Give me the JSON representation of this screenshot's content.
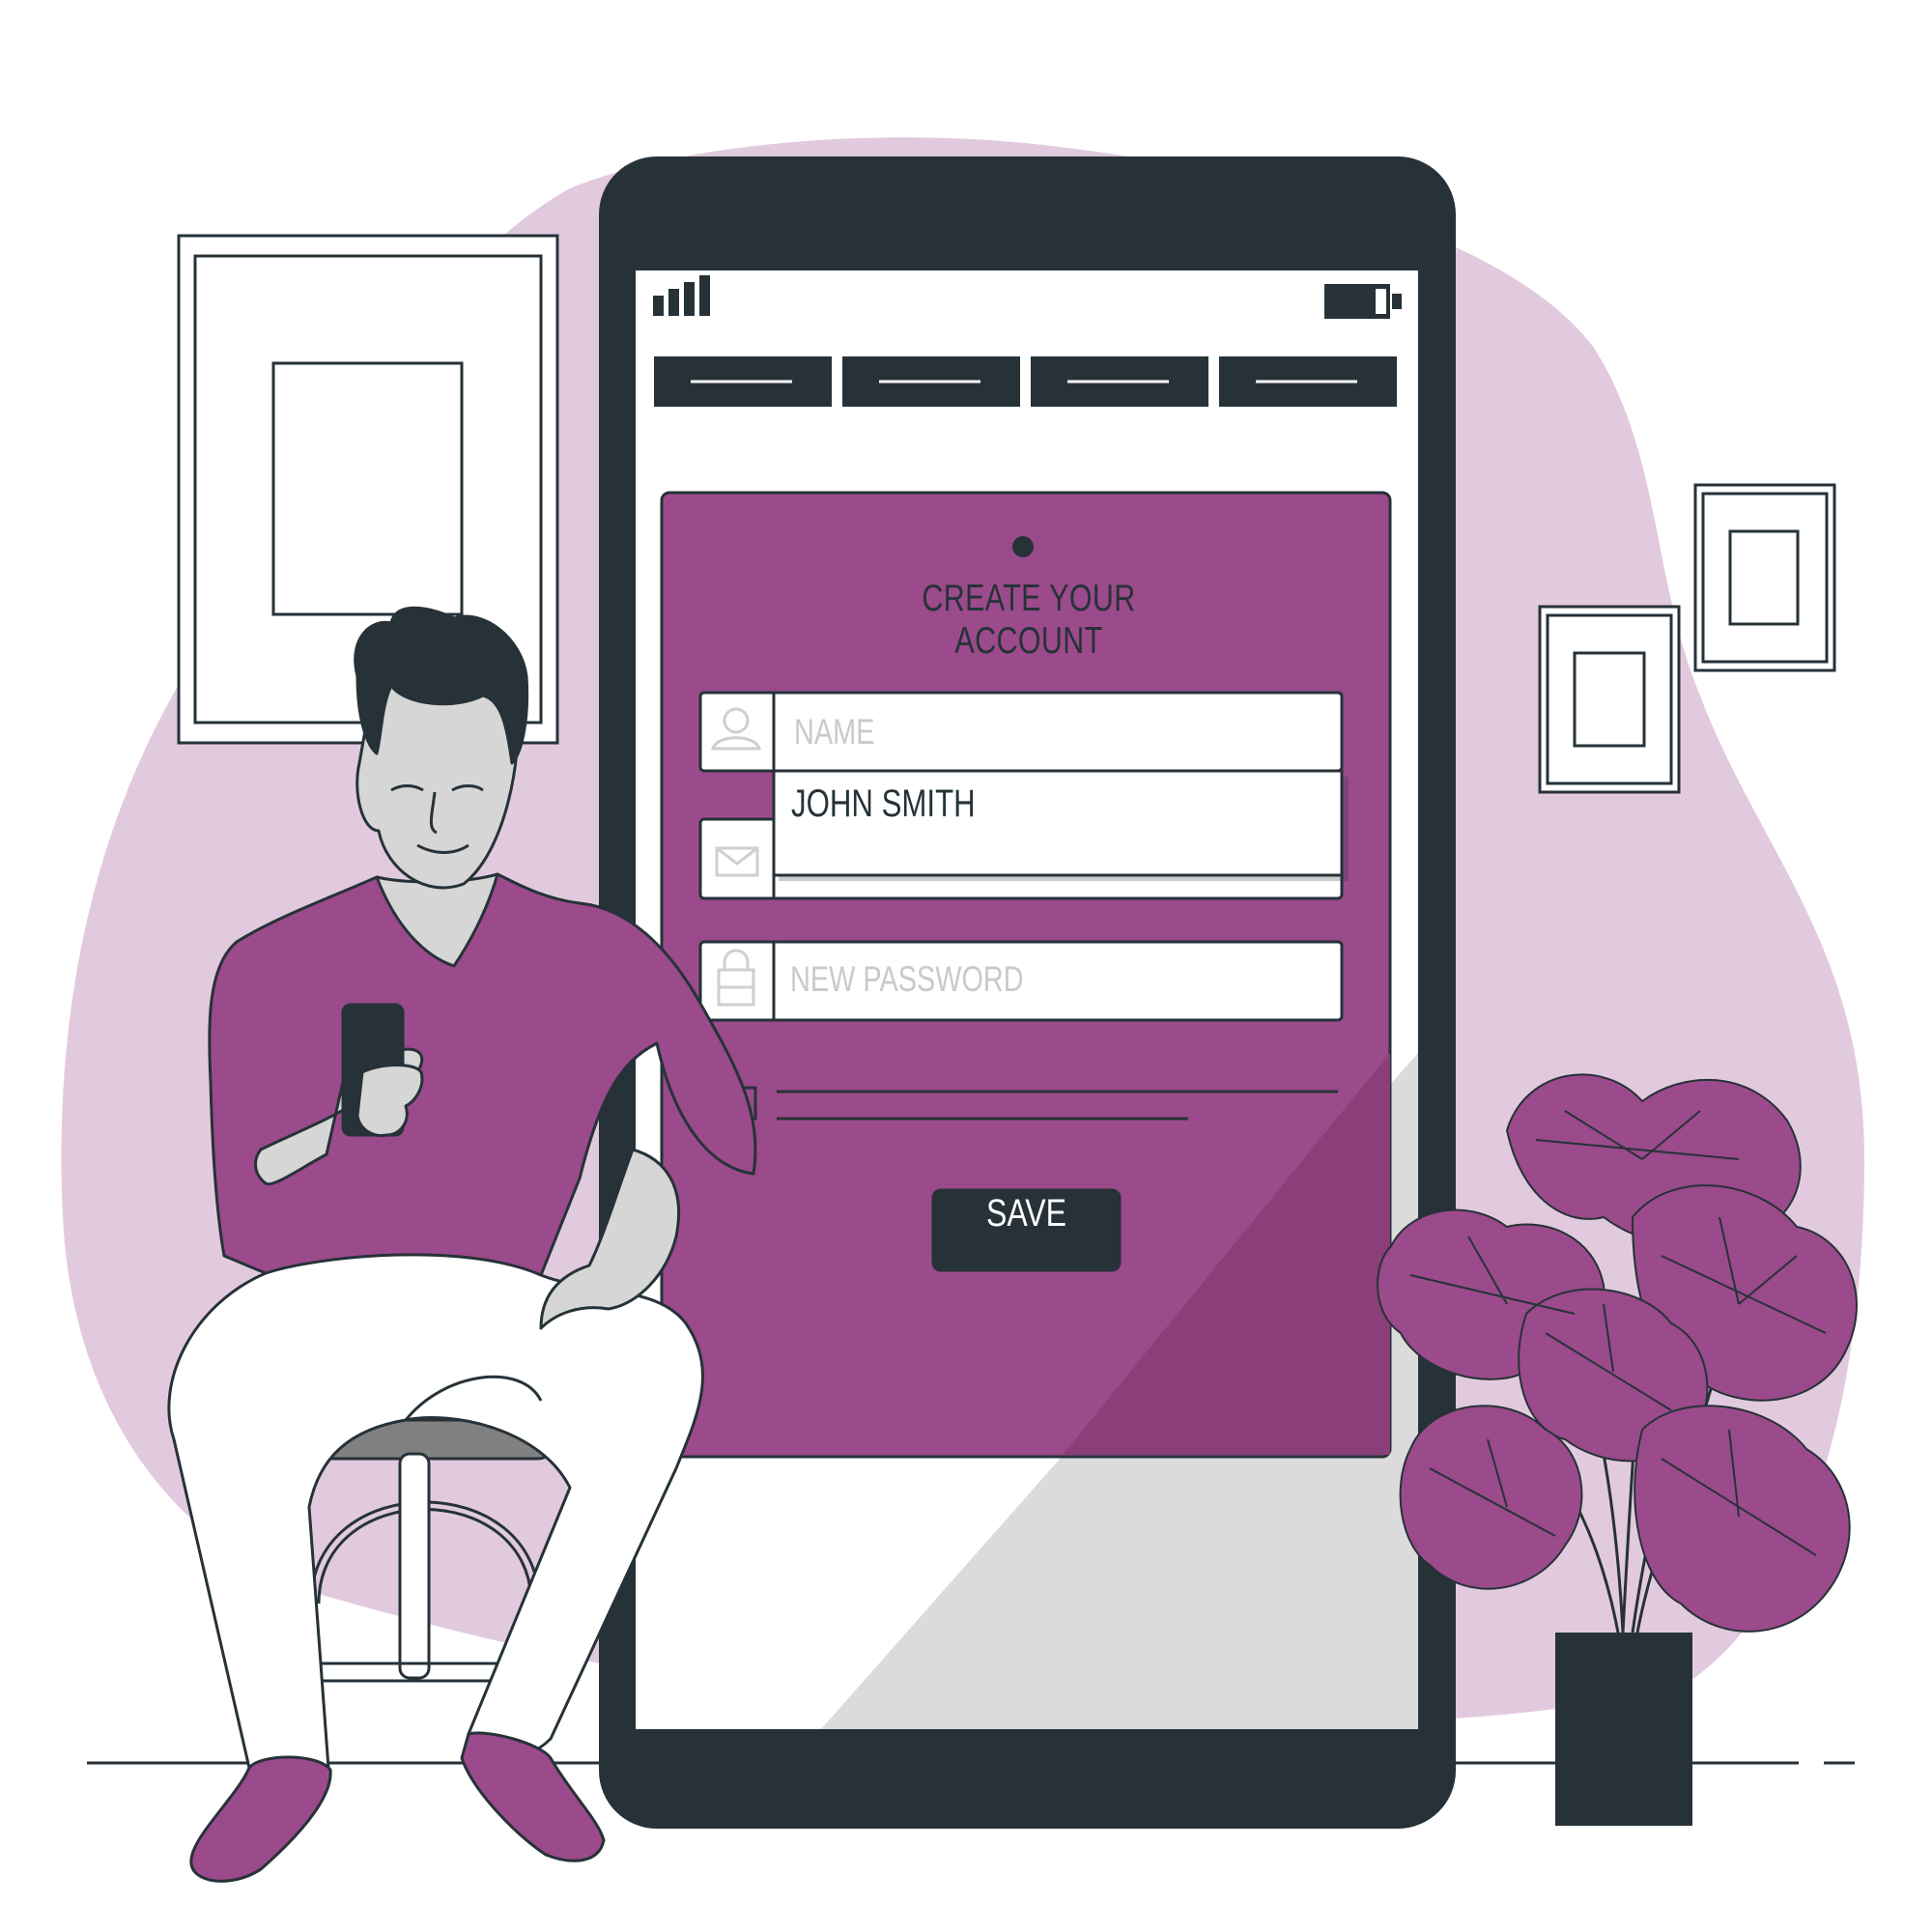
{
  "form": {
    "title": "CREATE YOUR ACCOUNT",
    "name_placeholder": "NAME",
    "name_suggestion": "JOHN SMITH",
    "password_placeholder": "NEW PASSWORD",
    "save_label": "SAVE"
  },
  "status_bar": {
    "signal_icon": "signal-bars-icon",
    "battery_icon": "battery-icon"
  },
  "nav_tabs": [
    "tab-1",
    "tab-2",
    "tab-3",
    "tab-4"
  ],
  "icons": {
    "name_field": "user-icon",
    "email_field": "envelope-icon",
    "password_field": "lock-icon"
  },
  "colors": {
    "accent": "#9B4A8B",
    "accent_dark": "#8A3F78",
    "dark": "#263238",
    "blob": "#E2CADE",
    "skin": "#D6D6D6"
  }
}
